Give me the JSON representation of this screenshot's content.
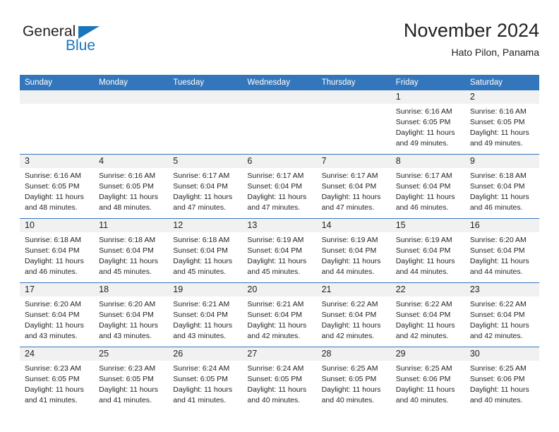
{
  "brand": {
    "word_top": "General",
    "word_bottom": "Blue",
    "triangle_color": "#1b75bb",
    "blue_color": "#1b75bb"
  },
  "header": {
    "title": "November 2024",
    "subtitle": "Hato Pilon, Panama"
  },
  "theme": {
    "header_blue": "#3476bb",
    "number_row_gray": "#f1f1f1",
    "text": "#231f20"
  },
  "weekdays": [
    "Sunday",
    "Monday",
    "Tuesday",
    "Wednesday",
    "Thursday",
    "Friday",
    "Saturday"
  ],
  "weeks": [
    {
      "numbers": [
        "",
        "",
        "",
        "",
        "",
        "1",
        "2"
      ],
      "cells": [
        {
          "empty": true
        },
        {
          "empty": true
        },
        {
          "empty": true
        },
        {
          "empty": true
        },
        {
          "empty": true
        },
        {
          "sunrise": "Sunrise: 6:16 AM",
          "sunset": "Sunset: 6:05 PM",
          "daylight_1": "Daylight: 11 hours",
          "daylight_2": "and 49 minutes."
        },
        {
          "sunrise": "Sunrise: 6:16 AM",
          "sunset": "Sunset: 6:05 PM",
          "daylight_1": "Daylight: 11 hours",
          "daylight_2": "and 49 minutes."
        }
      ]
    },
    {
      "numbers": [
        "3",
        "4",
        "5",
        "6",
        "7",
        "8",
        "9"
      ],
      "cells": [
        {
          "sunrise": "Sunrise: 6:16 AM",
          "sunset": "Sunset: 6:05 PM",
          "daylight_1": "Daylight: 11 hours",
          "daylight_2": "and 48 minutes."
        },
        {
          "sunrise": "Sunrise: 6:16 AM",
          "sunset": "Sunset: 6:05 PM",
          "daylight_1": "Daylight: 11 hours",
          "daylight_2": "and 48 minutes."
        },
        {
          "sunrise": "Sunrise: 6:17 AM",
          "sunset": "Sunset: 6:04 PM",
          "daylight_1": "Daylight: 11 hours",
          "daylight_2": "and 47 minutes."
        },
        {
          "sunrise": "Sunrise: 6:17 AM",
          "sunset": "Sunset: 6:04 PM",
          "daylight_1": "Daylight: 11 hours",
          "daylight_2": "and 47 minutes."
        },
        {
          "sunrise": "Sunrise: 6:17 AM",
          "sunset": "Sunset: 6:04 PM",
          "daylight_1": "Daylight: 11 hours",
          "daylight_2": "and 47 minutes."
        },
        {
          "sunrise": "Sunrise: 6:17 AM",
          "sunset": "Sunset: 6:04 PM",
          "daylight_1": "Daylight: 11 hours",
          "daylight_2": "and 46 minutes."
        },
        {
          "sunrise": "Sunrise: 6:18 AM",
          "sunset": "Sunset: 6:04 PM",
          "daylight_1": "Daylight: 11 hours",
          "daylight_2": "and 46 minutes."
        }
      ]
    },
    {
      "numbers": [
        "10",
        "11",
        "12",
        "13",
        "14",
        "15",
        "16"
      ],
      "cells": [
        {
          "sunrise": "Sunrise: 6:18 AM",
          "sunset": "Sunset: 6:04 PM",
          "daylight_1": "Daylight: 11 hours",
          "daylight_2": "and 46 minutes."
        },
        {
          "sunrise": "Sunrise: 6:18 AM",
          "sunset": "Sunset: 6:04 PM",
          "daylight_1": "Daylight: 11 hours",
          "daylight_2": "and 45 minutes."
        },
        {
          "sunrise": "Sunrise: 6:18 AM",
          "sunset": "Sunset: 6:04 PM",
          "daylight_1": "Daylight: 11 hours",
          "daylight_2": "and 45 minutes."
        },
        {
          "sunrise": "Sunrise: 6:19 AM",
          "sunset": "Sunset: 6:04 PM",
          "daylight_1": "Daylight: 11 hours",
          "daylight_2": "and 45 minutes."
        },
        {
          "sunrise": "Sunrise: 6:19 AM",
          "sunset": "Sunset: 6:04 PM",
          "daylight_1": "Daylight: 11 hours",
          "daylight_2": "and 44 minutes."
        },
        {
          "sunrise": "Sunrise: 6:19 AM",
          "sunset": "Sunset: 6:04 PM",
          "daylight_1": "Daylight: 11 hours",
          "daylight_2": "and 44 minutes."
        },
        {
          "sunrise": "Sunrise: 6:20 AM",
          "sunset": "Sunset: 6:04 PM",
          "daylight_1": "Daylight: 11 hours",
          "daylight_2": "and 44 minutes."
        }
      ]
    },
    {
      "numbers": [
        "17",
        "18",
        "19",
        "20",
        "21",
        "22",
        "23"
      ],
      "cells": [
        {
          "sunrise": "Sunrise: 6:20 AM",
          "sunset": "Sunset: 6:04 PM",
          "daylight_1": "Daylight: 11 hours",
          "daylight_2": "and 43 minutes."
        },
        {
          "sunrise": "Sunrise: 6:20 AM",
          "sunset": "Sunset: 6:04 PM",
          "daylight_1": "Daylight: 11 hours",
          "daylight_2": "and 43 minutes."
        },
        {
          "sunrise": "Sunrise: 6:21 AM",
          "sunset": "Sunset: 6:04 PM",
          "daylight_1": "Daylight: 11 hours",
          "daylight_2": "and 43 minutes."
        },
        {
          "sunrise": "Sunrise: 6:21 AM",
          "sunset": "Sunset: 6:04 PM",
          "daylight_1": "Daylight: 11 hours",
          "daylight_2": "and 42 minutes."
        },
        {
          "sunrise": "Sunrise: 6:22 AM",
          "sunset": "Sunset: 6:04 PM",
          "daylight_1": "Daylight: 11 hours",
          "daylight_2": "and 42 minutes."
        },
        {
          "sunrise": "Sunrise: 6:22 AM",
          "sunset": "Sunset: 6:04 PM",
          "daylight_1": "Daylight: 11 hours",
          "daylight_2": "and 42 minutes."
        },
        {
          "sunrise": "Sunrise: 6:22 AM",
          "sunset": "Sunset: 6:04 PM",
          "daylight_1": "Daylight: 11 hours",
          "daylight_2": "and 42 minutes."
        }
      ]
    },
    {
      "numbers": [
        "24",
        "25",
        "26",
        "27",
        "28",
        "29",
        "30"
      ],
      "cells": [
        {
          "sunrise": "Sunrise: 6:23 AM",
          "sunset": "Sunset: 6:05 PM",
          "daylight_1": "Daylight: 11 hours",
          "daylight_2": "and 41 minutes."
        },
        {
          "sunrise": "Sunrise: 6:23 AM",
          "sunset": "Sunset: 6:05 PM",
          "daylight_1": "Daylight: 11 hours",
          "daylight_2": "and 41 minutes."
        },
        {
          "sunrise": "Sunrise: 6:24 AM",
          "sunset": "Sunset: 6:05 PM",
          "daylight_1": "Daylight: 11 hours",
          "daylight_2": "and 41 minutes."
        },
        {
          "sunrise": "Sunrise: 6:24 AM",
          "sunset": "Sunset: 6:05 PM",
          "daylight_1": "Daylight: 11 hours",
          "daylight_2": "and 40 minutes."
        },
        {
          "sunrise": "Sunrise: 6:25 AM",
          "sunset": "Sunset: 6:05 PM",
          "daylight_1": "Daylight: 11 hours",
          "daylight_2": "and 40 minutes."
        },
        {
          "sunrise": "Sunrise: 6:25 AM",
          "sunset": "Sunset: 6:06 PM",
          "daylight_1": "Daylight: 11 hours",
          "daylight_2": "and 40 minutes."
        },
        {
          "sunrise": "Sunrise: 6:25 AM",
          "sunset": "Sunset: 6:06 PM",
          "daylight_1": "Daylight: 11 hours",
          "daylight_2": "and 40 minutes."
        }
      ]
    }
  ]
}
